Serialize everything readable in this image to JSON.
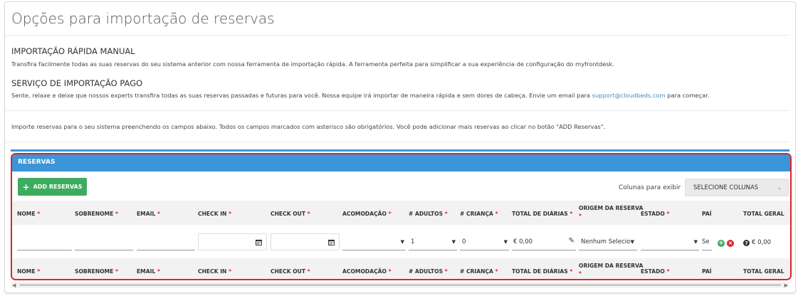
{
  "page": {
    "title": "Opções para importação de reservas"
  },
  "quick_import": {
    "heading": "IMPORTAÇÃO RÁPIDA MANUAL",
    "text": "Transfira facilmente todas as suas reservas do seu sistema anterior com nossa ferramenta de importação rápida. A ferramenta perfeita para simplificar a sua experiência de configuração do myfrontdesk."
  },
  "paid_import": {
    "heading": "SERVIÇO DE IMPORTAÇÃO PAGO",
    "text_before": "Sente, relaxe e deixe que nossos experts transfira todas as suas reservas passadas e futuras para você. Nossa equipe irá importar de maneira rápida e sem dores de cabeça. Envie um email para ",
    "email": "support@cloudbeds.com",
    "text_after": " para começar."
  },
  "instructions": "Importe reservas para o seu sistema preenchendo os campos abaixo. Todos os campos marcados com asterisco são obrigatórios. Você pode adicionar mais reservas ao clicar no botão \"ADD Reservas\".",
  "reservas": {
    "panel_title": "RESERVAS",
    "add_button": "ADD RESERVAS",
    "columns_label": "Colunas para exibir",
    "columns_select": "SELECIONE COLUNAS",
    "headers": {
      "nome": "NOME",
      "sobrenome": "SOBRENOME",
      "email": "EMAIL",
      "check_in": "CHECK IN",
      "check_out": "CHECK OUT",
      "acomodacao": "ACOMODAÇÃO",
      "adultos": "# ADULTOS",
      "criancas": "# CRIANÇA",
      "total_diarias": "TOTAL DE DIÁRIAS",
      "origem_line1": "ORIGEM DA RESERVA",
      "estado": "ESTADO",
      "pais": "PAÍ",
      "total_geral": "TOTAL GERAL",
      "required_mark": "*"
    },
    "row": {
      "adultos": "1",
      "criancas": "0",
      "total_diarias": "€ 0,00",
      "origem": "Nenhum Selecio",
      "pais": "Se",
      "total_geral": "€ 0,00"
    }
  },
  "colors": {
    "accent_blue": "#3b95d6",
    "add_green": "#3dac5e",
    "highlight_red": "#d9242f",
    "link_blue": "#3c8dbc"
  }
}
